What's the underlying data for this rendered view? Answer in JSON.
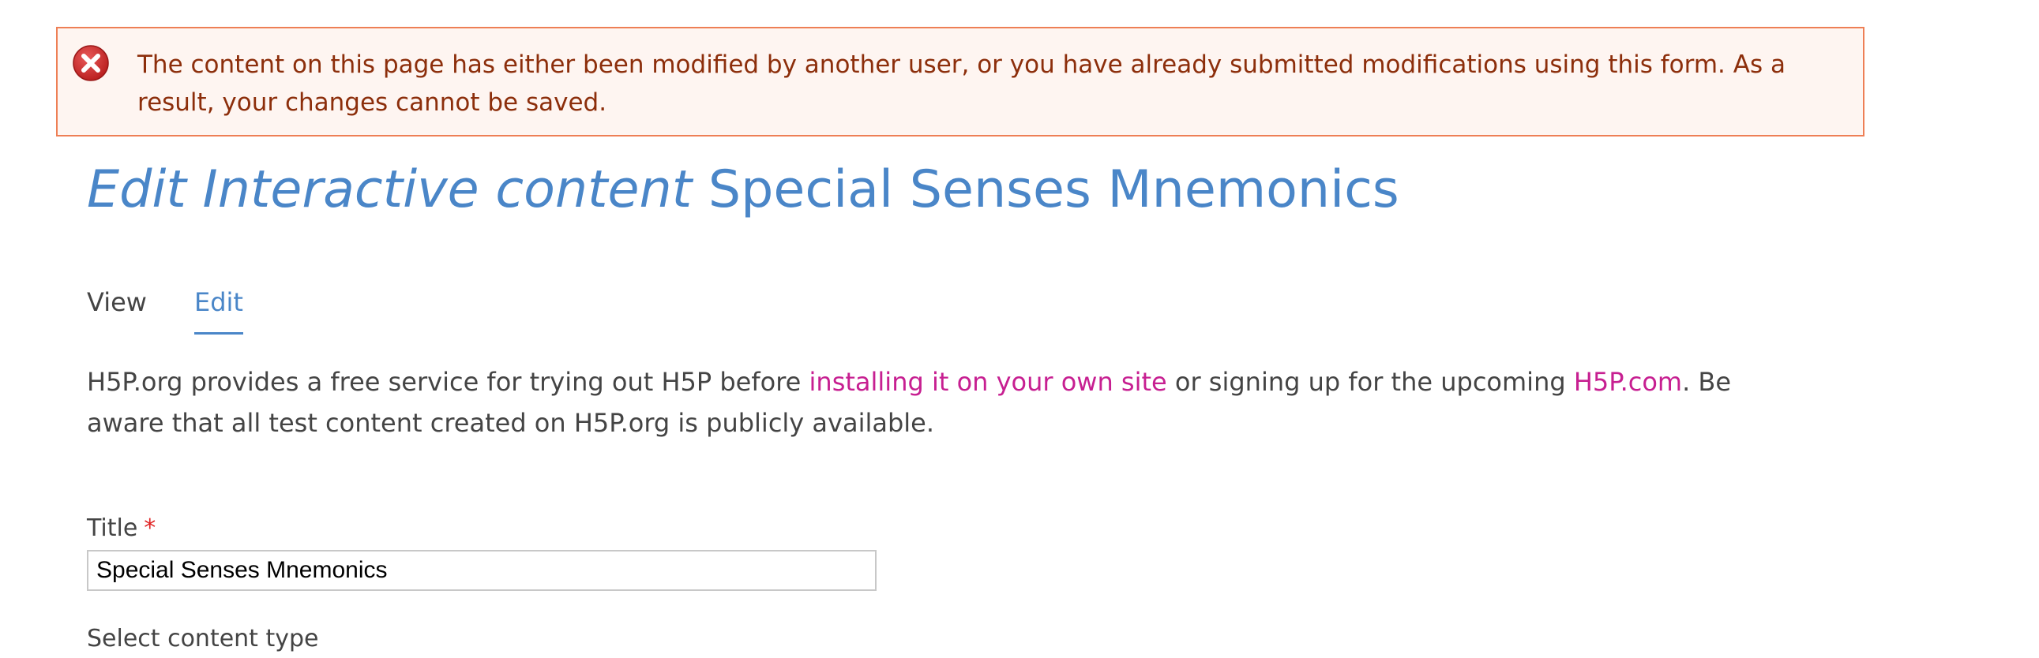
{
  "error": {
    "message": "The content on this page has either been modified by another user, or you have already submitted modifications using this form. As a result, your changes cannot be saved.",
    "icon": "error-x-icon",
    "color": "#8c2e0b",
    "border_color": "#ee7f55",
    "background": "#fef5f1"
  },
  "page": {
    "title_prefix": "Edit Interactive content",
    "title_name": "Special Senses Mnemonics",
    "title_color": "#4a86c8"
  },
  "tabs": [
    {
      "label": "View",
      "active": false
    },
    {
      "label": "Edit",
      "active": true
    }
  ],
  "intro": {
    "part1": "H5P.org provides a free service for trying out H5P before ",
    "link1": "installing it on your own site",
    "part2": " or signing up for the upcoming ",
    "link2": "H5P.com",
    "part3": ". Be aware that all test content created on H5P.org is publicly available.",
    "link_color": "#c71f91"
  },
  "form": {
    "title_label": "Title",
    "required_mark": "*",
    "title_value": "Special Senses Mnemonics",
    "select_label": "Select content type"
  }
}
